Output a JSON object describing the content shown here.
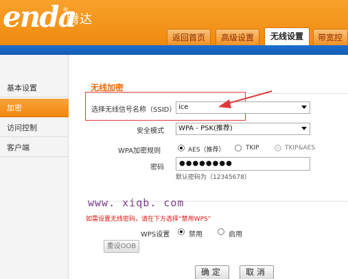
{
  "brand": {
    "logo": "enda",
    "logo_mark": "®",
    "logo_cn": "腾达"
  },
  "tabs": [
    {
      "label": "返回首页"
    },
    {
      "label": "高级设置"
    },
    {
      "label": "无线设置"
    },
    {
      "label": "带宽控"
    }
  ],
  "sidebar": {
    "items": [
      {
        "label": "基本设置"
      },
      {
        "label": "加密"
      },
      {
        "label": "访问控制"
      },
      {
        "label": "客户端"
      }
    ]
  },
  "form": {
    "section_title": "无线加密",
    "ssid": {
      "label": "选择无线信号名称（SSID）",
      "value": "ice"
    },
    "security": {
      "label": "安全模式",
      "value": "WPA - PSK(推荐)"
    },
    "wpa_rule": {
      "label": "WPA加密规则",
      "options": [
        {
          "label": "AES（推荐）",
          "selected": true,
          "disabled": false
        },
        {
          "label": "TKIP",
          "selected": false,
          "disabled": false
        },
        {
          "label": "TKIP&AES",
          "selected": false,
          "disabled": true
        }
      ]
    },
    "password": {
      "label": "密码",
      "value": "●●●●●●●●",
      "hint": "默认密码为（12345678）"
    }
  },
  "watermark": "www. xiqb. com",
  "warning": "如需设置无线密码，请在下方选择“禁用WPS”",
  "wps": {
    "label": "WPS设置",
    "options": [
      {
        "label": "禁用",
        "selected": true
      },
      {
        "label": "启用",
        "selected": false
      }
    ],
    "reset_label": "重设OOB"
  },
  "buttons": {
    "ok": "确定",
    "cancel": "取消"
  },
  "colors": {
    "header": "#f08a10",
    "accent_text": "#e56b0e",
    "annotation": "#e0393c",
    "nav_bar": "#155ab3"
  }
}
